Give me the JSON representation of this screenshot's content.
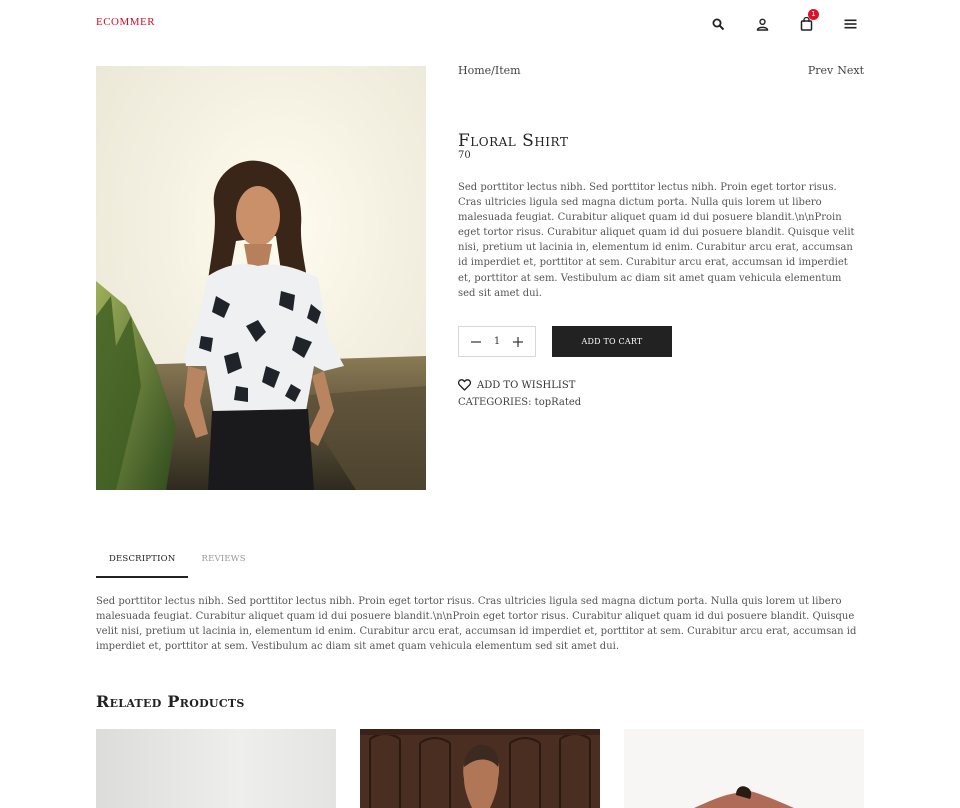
{
  "header": {
    "logo": "ECOMMER",
    "cart_count": "1",
    "icons": [
      "search-icon",
      "user-icon",
      "shopping-bag-icon",
      "menu-icon"
    ]
  },
  "breadcrumb": "Home/Item",
  "nav": {
    "prev": "Prev",
    "next": "Next"
  },
  "product": {
    "title": "Floral Shirt",
    "price": "70",
    "description": "Sed porttitor lectus nibh. Sed porttitor lectus nibh. Proin eget tortor risus. Cras ultricies ligula sed magna dictum porta. Nulla quis lorem ut libero malesuada feugiat. Curabitur aliquet quam id dui posuere blandit.\\n\\nProin eget tortor risus. Curabitur aliquet quam id dui posuere blandit. Quisque velit nisi, pretium ut lacinia in, elementum id enim. Curabitur arcu erat, accumsan id imperdiet et, porttitor at sem. Curabitur arcu erat, accumsan id imperdiet et, porttitor at sem. Vestibulum ac diam sit amet quam vehicula elementum sed sit amet dui.",
    "quantity": "1",
    "add_to_cart": "ADD TO CART",
    "wishlist": "ADD TO WISHLIST",
    "categories_label": "CATEGORIES:",
    "category": "topRated"
  },
  "tabs": {
    "description": "DESCRIPTION",
    "reviews": "REVIEWS",
    "content": "Sed porttitor lectus nibh. Sed porttitor lectus nibh. Proin eget tortor risus. Cras ultricies ligula sed magna dictum porta. Nulla quis lorem ut libero malesuada feugiat. Curabitur aliquet quam id dui posuere blandit.\\n\\nProin eget tortor risus. Curabitur aliquet quam id dui posuere blandit. Quisque velit nisi, pretium ut lacinia in, elementum id enim. Curabitur arcu erat, accumsan id imperdiet et, porttitor at sem. Curabitur arcu erat, accumsan id imperdiet et, porttitor at sem. Vestibulum ac diam sit amet quam vehicula elementum sed sit amet dui."
  },
  "related": {
    "title": "Related Products"
  },
  "colors": {
    "brand": "#c8102e",
    "badge": "#e0102c",
    "button": "#222222"
  }
}
